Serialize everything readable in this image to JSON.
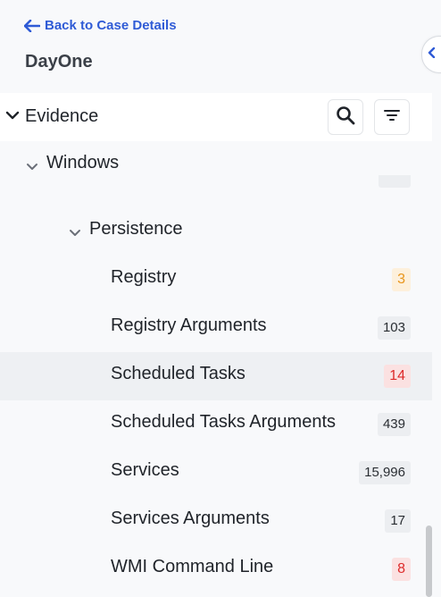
{
  "back": {
    "label": "Back to Case Details"
  },
  "case": {
    "name": "DayOne"
  },
  "evidence": {
    "label": "Evidence"
  },
  "tree": {
    "windows": "Windows",
    "persistence": "Persistence",
    "items": [
      {
        "label": "Registry",
        "count": "3",
        "severity": "orange"
      },
      {
        "label": "Registry Arguments",
        "count": "103",
        "severity": "neutral"
      },
      {
        "label": "Scheduled Tasks",
        "count": "14",
        "severity": "red"
      },
      {
        "label": "Scheduled Tasks Arguments",
        "count": "439",
        "severity": "neutral"
      },
      {
        "label": "Services",
        "count": "15,996",
        "severity": "neutral"
      },
      {
        "label": "Services Arguments",
        "count": "17",
        "severity": "neutral"
      },
      {
        "label": "WMI Command Line",
        "count": "8",
        "severity": "red"
      }
    ]
  },
  "colors": {
    "accent": "#2f5bd6",
    "orange": "#e8951c",
    "red": "#dd2b2b",
    "highlight": "#eef0f3"
  },
  "icons": [
    "arrow-left-icon",
    "chevron-left-icon",
    "chevron-down-icon",
    "search-icon",
    "filter-icon"
  ]
}
